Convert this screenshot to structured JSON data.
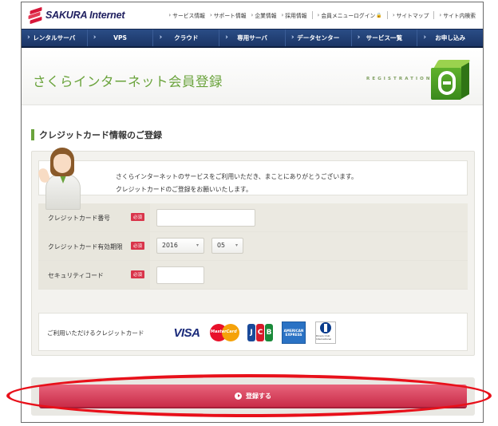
{
  "header": {
    "logo_text": "SAKURA Internet",
    "top_links": [
      "サービス情報",
      "サポート情報",
      "企業情報",
      "採用情報",
      "会員メニューログイン",
      "サイトマップ",
      "サイト内検索"
    ]
  },
  "main_nav": [
    "レンタルサーバ",
    "VPS",
    "クラウド",
    "専用サーバ",
    "データセンター",
    "サービス一覧",
    "お申し込み"
  ],
  "title_band": {
    "page_title": "さくらインターネット会員登録",
    "registration_label": "REGISTRATION"
  },
  "section": {
    "title": "クレジットカード情報のご登録"
  },
  "greeting": {
    "line1": "さくらインターネットのサービスをご利用いただき、まことにありがとうございます。",
    "line2": "クレジットカードのご登録をお願いいたします。"
  },
  "form": {
    "required_badge": "必須",
    "card_number_label": "クレジットカード番号",
    "card_number_value": "",
    "expiry_label": "クレジットカード有効期限",
    "expiry_year": "2016",
    "expiry_month": "05",
    "security_code_label": "セキュリティコード",
    "security_code_value": ""
  },
  "cards": {
    "label": "ご利用いただけるクレジットカード",
    "visa": "VISA",
    "mastercard": "MasterCard",
    "jcb": [
      "J",
      "C",
      "B"
    ],
    "amex": "AMERICAN EXPRESS",
    "diners": "Diners Club International"
  },
  "submit": {
    "label": "登録する"
  },
  "colors": {
    "brand_green": "#6aa33c",
    "nav_blue": "#1b3566",
    "submit_red": "#c92c48",
    "highlight_red": "#e8101a"
  }
}
